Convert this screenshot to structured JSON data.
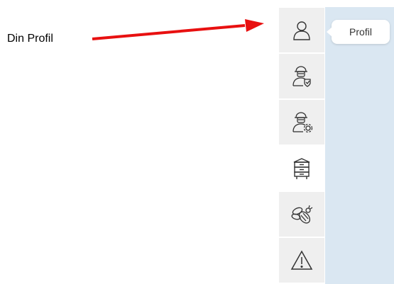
{
  "annotation": {
    "label": "Din Profil",
    "arrow_color": "#e81010"
  },
  "tooltip": {
    "text": "Profil"
  },
  "sidebar": {
    "items": [
      {
        "icon": "user-icon",
        "active": false
      },
      {
        "icon": "beekeeper-shield-icon",
        "active": false
      },
      {
        "icon": "beekeeper-settings-icon",
        "active": false
      },
      {
        "icon": "beehive-icon",
        "active": true
      },
      {
        "icon": "bee-icon",
        "active": false
      },
      {
        "icon": "warning-icon",
        "active": false
      }
    ]
  },
  "colors": {
    "panel_bg": "#dae7f2",
    "button_bg": "#efefef",
    "icon_stroke": "#333333"
  }
}
